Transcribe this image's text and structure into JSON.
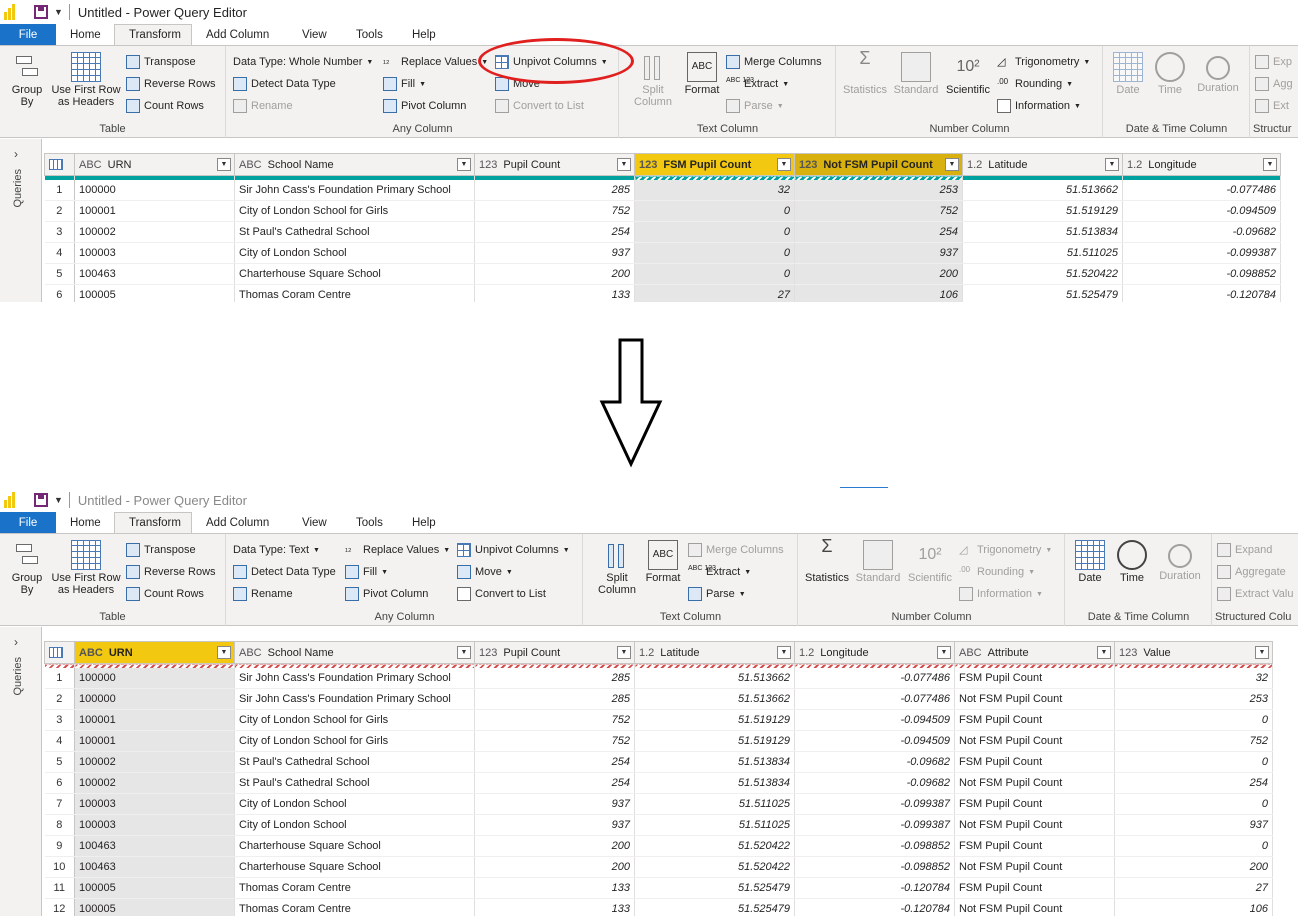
{
  "window": {
    "title": "Untitled - Power Query Editor"
  },
  "tabs": [
    "File",
    "Home",
    "Transform",
    "Add Column",
    "View",
    "Tools",
    "Help"
  ],
  "active_tab": "Transform",
  "ribbon_top": {
    "table": {
      "label": "Table",
      "group_by": "Group By",
      "use_first_row": "Use First Row as Headers",
      "transpose": "Transpose",
      "reverse_rows": "Reverse Rows",
      "count_rows": "Count Rows"
    },
    "any_column": {
      "label": "Any Column",
      "data_type": "Data Type: Whole Number",
      "detect": "Detect Data Type",
      "rename": "Rename",
      "replace": "Replace Values",
      "fill": "Fill",
      "pivot": "Pivot Column",
      "unpivot": "Unpivot Columns",
      "move": "Move",
      "convert": "Convert to List"
    },
    "text_column": {
      "label": "Text Column",
      "split": "Split Column",
      "format": "Format",
      "merge": "Merge Columns",
      "extract": "Extract",
      "parse": "Parse"
    },
    "number_column": {
      "label": "Number Column",
      "statistics": "Statistics",
      "standard": "Standard",
      "scientific": "Scientific",
      "trig": "Trigonometry",
      "rounding": "Rounding",
      "information": "Information"
    },
    "datetime": {
      "label": "Date & Time Column",
      "date": "Date",
      "time": "Time",
      "duration": "Duration"
    },
    "structured": {
      "label": "Structur",
      "expand": "Exp",
      "aggregate": "Agg",
      "extract": "Ext"
    }
  },
  "ribbon_bottom": {
    "table": {
      "label": "Table",
      "group_by": "Group By",
      "use_first_row": "Use First Row as Headers",
      "transpose": "Transpose",
      "reverse_rows": "Reverse Rows",
      "count_rows": "Count Rows"
    },
    "any_column": {
      "label": "Any Column",
      "data_type": "Data Type: Text",
      "detect": "Detect Data Type",
      "rename": "Rename",
      "replace": "Replace Values",
      "fill": "Fill",
      "pivot": "Pivot Column",
      "unpivot": "Unpivot Columns",
      "move": "Move",
      "convert": "Convert to List"
    },
    "text_column": {
      "label": "Text Column",
      "split": "Split Column",
      "format": "Format",
      "merge": "Merge Columns",
      "extract": "Extract",
      "parse": "Parse"
    },
    "number_column": {
      "label": "Number Column",
      "statistics": "Statistics",
      "standard": "Standard",
      "scientific": "Scientific",
      "trig": "Trigonometry",
      "rounding": "Rounding",
      "information": "Information"
    },
    "datetime": {
      "label": "Date & Time Column",
      "date": "Date",
      "time": "Time",
      "duration": "Duration"
    },
    "structured": {
      "label": "Structured Colu",
      "expand": "Expand",
      "aggregate": "Aggregate",
      "extract": "Extract Valu"
    }
  },
  "queries_label": "Queries",
  "top_table": {
    "columns": [
      {
        "type": "ABC",
        "name": "URN"
      },
      {
        "type": "ABC",
        "name": "School Name"
      },
      {
        "type": "123",
        "name": "Pupil Count"
      },
      {
        "type": "123",
        "name": "FSM Pupil Count"
      },
      {
        "type": "123",
        "name": "Not FSM Pupil Count"
      },
      {
        "type": "1.2",
        "name": "Latitude"
      },
      {
        "type": "1.2",
        "name": "Longitude"
      }
    ],
    "rows": [
      [
        "1",
        "100000",
        "Sir John Cass's Foundation Primary School",
        "285",
        "32",
        "253",
        "51.513662",
        "-0.077486"
      ],
      [
        "2",
        "100001",
        "City of London School for Girls",
        "752",
        "0",
        "752",
        "51.519129",
        "-0.094509"
      ],
      [
        "3",
        "100002",
        "St Paul's Cathedral School",
        "254",
        "0",
        "254",
        "51.513834",
        "-0.09682"
      ],
      [
        "4",
        "100003",
        "City of London School",
        "937",
        "0",
        "937",
        "51.511025",
        "-0.099387"
      ],
      [
        "5",
        "100463",
        "Charterhouse Square School",
        "200",
        "0",
        "200",
        "51.520422",
        "-0.098852"
      ],
      [
        "6",
        "100005",
        "Thomas Coram Centre",
        "133",
        "27",
        "106",
        "51.525479",
        "-0.120784"
      ]
    ]
  },
  "bottom_table": {
    "columns": [
      {
        "type": "ABC",
        "name": "URN"
      },
      {
        "type": "ABC",
        "name": "School Name"
      },
      {
        "type": "123",
        "name": "Pupil Count"
      },
      {
        "type": "1.2",
        "name": "Latitude"
      },
      {
        "type": "1.2",
        "name": "Longitude"
      },
      {
        "type": "ABC",
        "name": "Attribute"
      },
      {
        "type": "123",
        "name": "Value"
      }
    ],
    "rows": [
      [
        "1",
        "100000",
        "Sir John Cass's Foundation Primary School",
        "285",
        "51.513662",
        "-0.077486",
        "FSM Pupil Count",
        "32"
      ],
      [
        "2",
        "100000",
        "Sir John Cass's Foundation Primary School",
        "285",
        "51.513662",
        "-0.077486",
        "Not FSM Pupil Count",
        "253"
      ],
      [
        "3",
        "100001",
        "City of London School for Girls",
        "752",
        "51.519129",
        "-0.094509",
        "FSM Pupil Count",
        "0"
      ],
      [
        "4",
        "100001",
        "City of London School for Girls",
        "752",
        "51.519129",
        "-0.094509",
        "Not FSM Pupil Count",
        "752"
      ],
      [
        "5",
        "100002",
        "St Paul's Cathedral School",
        "254",
        "51.513834",
        "-0.09682",
        "FSM Pupil Count",
        "0"
      ],
      [
        "6",
        "100002",
        "St Paul's Cathedral School",
        "254",
        "51.513834",
        "-0.09682",
        "Not FSM Pupil Count",
        "254"
      ],
      [
        "7",
        "100003",
        "City of London School",
        "937",
        "51.511025",
        "-0.099387",
        "FSM Pupil Count",
        "0"
      ],
      [
        "8",
        "100003",
        "City of London School",
        "937",
        "51.511025",
        "-0.099387",
        "Not FSM Pupil Count",
        "937"
      ],
      [
        "9",
        "100463",
        "Charterhouse Square School",
        "200",
        "51.520422",
        "-0.098852",
        "FSM Pupil Count",
        "0"
      ],
      [
        "10",
        "100463",
        "Charterhouse Square School",
        "200",
        "51.520422",
        "-0.098852",
        "Not FSM Pupil Count",
        "200"
      ],
      [
        "11",
        "100005",
        "Thomas Coram Centre",
        "133",
        "51.525479",
        "-0.120784",
        "FSM Pupil Count",
        "27"
      ],
      [
        "12",
        "100005",
        "Thomas Coram Centre",
        "133",
        "51.525479",
        "-0.120784",
        "Not FSM Pupil Count",
        "106"
      ]
    ]
  },
  "colors": {
    "file_tab": "#1a73c9",
    "selected_header": "#f2c811",
    "quality_bar": "#00a2a0",
    "annotation": "#e0201f"
  }
}
